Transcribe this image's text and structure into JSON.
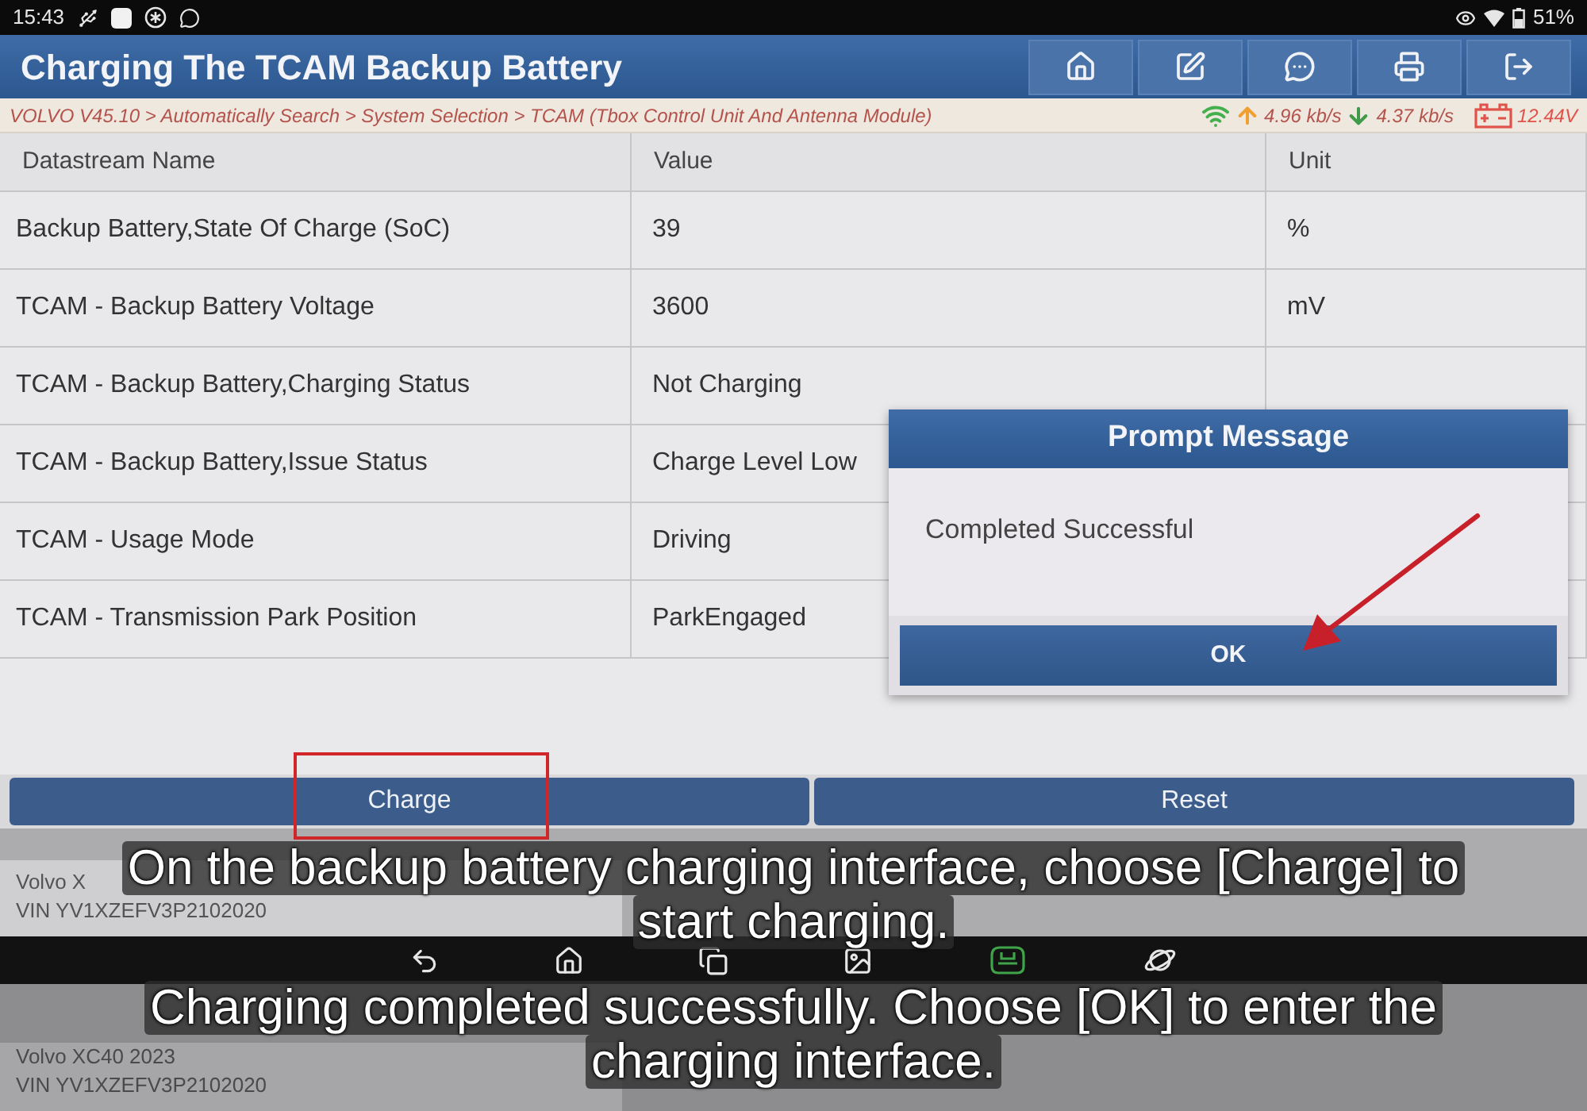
{
  "status_bar": {
    "time": "15:43",
    "battery": "51%"
  },
  "header": {
    "title": "Charging The TCAM Backup Battery"
  },
  "breadcrumb": "VOLVO V45.10 > Automatically Search > System Selection > TCAM (Tbox Control Unit And Antenna Module)",
  "link_status": {
    "upload": "4.96 kb/s",
    "download": "4.37 kb/s",
    "voltage": "12.44V"
  },
  "table": {
    "columns": [
      "Datastream Name",
      "Value",
      "Unit"
    ],
    "rows": [
      {
        "name": "Backup Battery,State Of Charge (SoC)",
        "value": "39",
        "unit": "%"
      },
      {
        "name": "TCAM - Backup Battery Voltage",
        "value": "3600",
        "unit": "mV"
      },
      {
        "name": "TCAM - Backup Battery,Charging Status",
        "value": "Not Charging"
      },
      {
        "name": "TCAM - Backup Battery,Issue Status",
        "value": "Charge Level Low"
      },
      {
        "name": "TCAM - Usage Mode",
        "value": "Driving"
      },
      {
        "name": "TCAM - Transmission Park Position",
        "value": "ParkEngaged"
      }
    ]
  },
  "actions": [
    {
      "label": "Charge"
    },
    {
      "label": "Reset"
    }
  ],
  "dialog": {
    "title": "Prompt Message",
    "message": "Completed Successful",
    "button": "OK"
  },
  "vehicle_history": [
    {
      "name": "Volvo X",
      "vin": "VIN YV1XZEFV3P2102020"
    },
    {
      "name": "Volvo XC40 2023",
      "vin": "VIN YV1XZEFV3P2102020"
    }
  ],
  "subtitles": [
    {
      "lines": [
        "On the backup battery charging interface, choose [Charge] to",
        "start charging."
      ]
    },
    {
      "lines": [
        "Charging completed successfully. Choose [OK] to enter the",
        "charging interface."
      ]
    }
  ]
}
